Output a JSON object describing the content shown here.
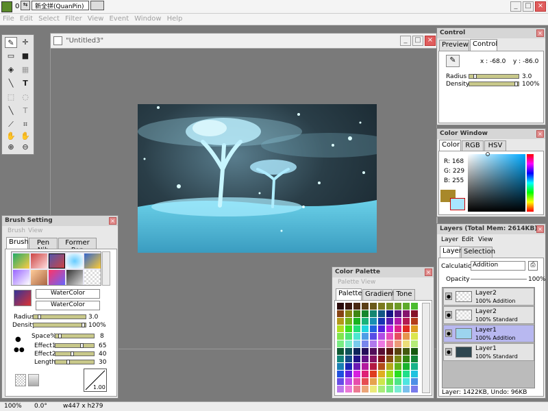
{
  "app": {
    "title": "0",
    "ime": "新全拼(QuanPin)",
    "menu": [
      "File",
      "Edit",
      "Select",
      "Filter",
      "View",
      "Event",
      "Window",
      "Help"
    ]
  },
  "status": {
    "zoom": "100%",
    "angle": "0.0°",
    "size": "w447 x h279"
  },
  "canvas": {
    "title": "\"Untitled3\""
  },
  "control": {
    "title": "Control",
    "tabs": [
      "Preview",
      "Control"
    ],
    "x": "x : -68.0",
    "y": "y : -86.0",
    "radius_label": "Radius",
    "radius": "3.0",
    "radius_level": 0.08,
    "density_label": "Density",
    "density": "100%",
    "density_level": 1.0
  },
  "color_window": {
    "title": "Color Window",
    "tabs": [
      "Color",
      "RGB",
      "HSV"
    ],
    "r": "R: 168",
    "g": "G: 229",
    "b": "B: 255",
    "main_color": "#a8e5ff",
    "secondary_color": "#a8882a"
  },
  "brush": {
    "title": "Brush Setting",
    "menu": [
      "Brush",
      "View"
    ],
    "tabs": [
      "Brush",
      "Pen Nib",
      "Former Pen"
    ],
    "name1": "WaterColor",
    "name2": "WaterColor",
    "radius_label": "Radius",
    "radius": "3.0",
    "density_label": "Density",
    "density": "100%",
    "space_label": "Space%",
    "space": "8",
    "effect1_label": "Effect1",
    "effect1": "65",
    "effect2_label": "Effect2",
    "effect2": "40",
    "length_label": "Length",
    "length": "30",
    "preview_value": "1.00"
  },
  "palette": {
    "title": "Color Palette",
    "menu": [
      "Palette",
      "View"
    ],
    "tabs": [
      "Palette",
      "Gradient",
      "Tone"
    ]
  },
  "layers": {
    "title": "Layers (Total Mem: 2614KB)",
    "menu": [
      "Layer",
      "Edit",
      "View"
    ],
    "tabs": [
      "Layer",
      "Selection"
    ],
    "calc_label": "Calculation",
    "calc_value": "Addition",
    "opacity_label": "Opacity",
    "opacity": "100%",
    "items": [
      {
        "name": "Layer2",
        "mode": "100% Addition"
      },
      {
        "name": "Layer2",
        "mode": "100% Standard"
      },
      {
        "name": "Layer1",
        "mode": "100% Addition"
      },
      {
        "name": "Layer1",
        "mode": "100% Standard"
      }
    ],
    "footer": "Layer: 1422KB, Undo: 96KB"
  },
  "tools": [
    "pen",
    "move",
    "select-rect",
    "fill-rect",
    "bucket",
    "gradient",
    "line",
    "text",
    "marquee",
    "lasso",
    "magic-line",
    "text-vert",
    "eyedropper",
    "crop",
    "hand",
    "rotate-hand",
    "zoom-in",
    "zoom-out"
  ],
  "icons": {
    "window_min": "_",
    "window_max": "□",
    "window_close": "×",
    "panel_close": "×",
    "layer_eye": "●"
  }
}
